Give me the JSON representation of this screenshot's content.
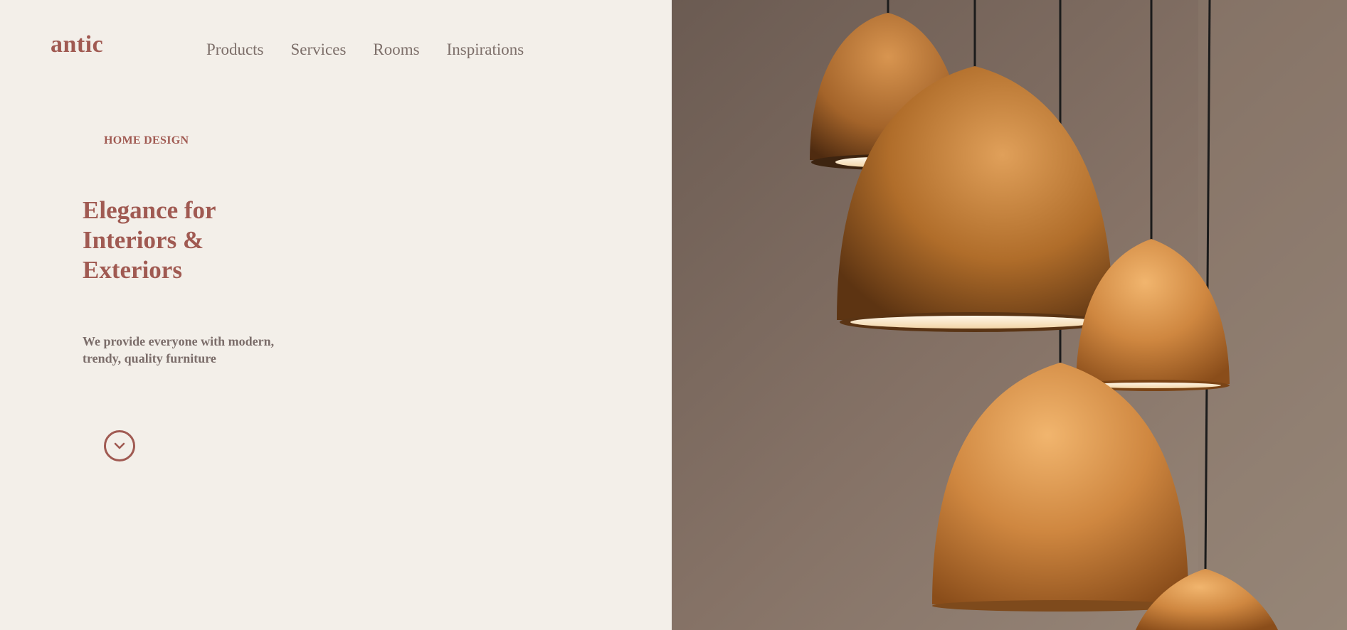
{
  "brand": {
    "logo_text": "antic"
  },
  "nav": {
    "items": [
      {
        "label": "Products"
      },
      {
        "label": "Services"
      },
      {
        "label": "Rooms"
      },
      {
        "label": "Inspirations"
      }
    ]
  },
  "hero": {
    "eyebrow": "HOME DESIGN",
    "headline_lines": [
      "Elegance for",
      "Interiors &",
      "Exteriors"
    ],
    "subtext_lines": [
      "We provide everyone with modern,",
      "trendy, quality furniture"
    ],
    "scroll_icon": "chevron-down-icon",
    "image_subject": "copper pendant lamps"
  },
  "colors": {
    "background": "#f3efe9",
    "accent": "#a05a52",
    "muted_text": "#7b6d6a",
    "copper": "#c0803f"
  }
}
